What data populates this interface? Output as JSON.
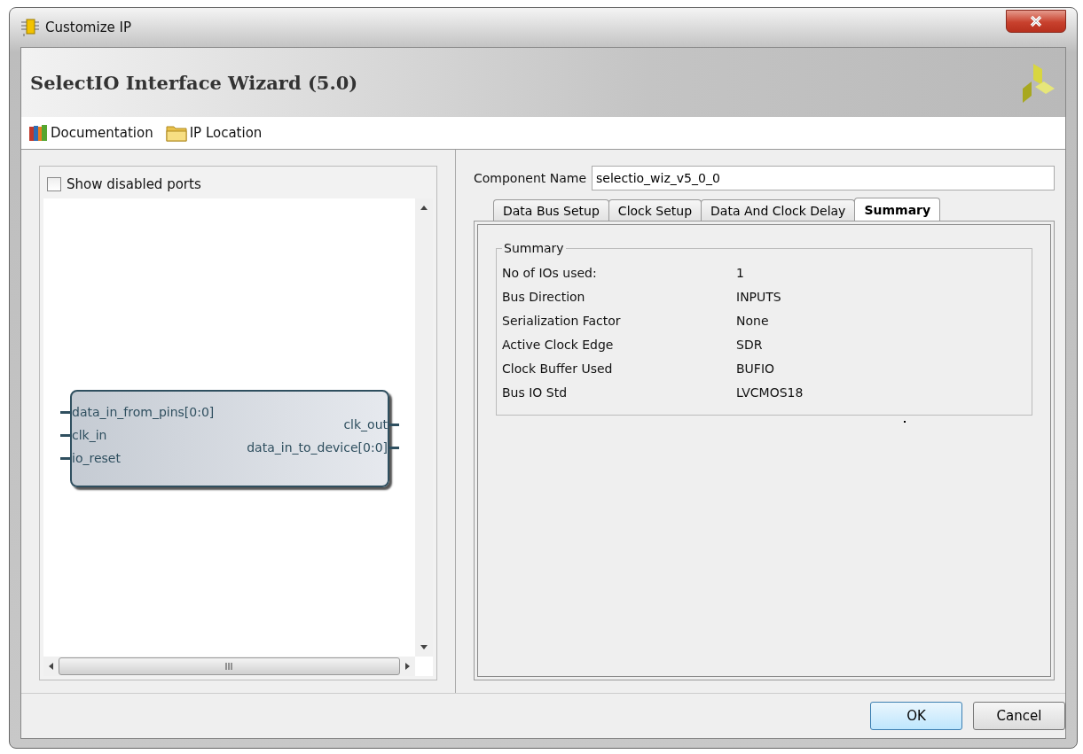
{
  "window": {
    "title": "Customize IP"
  },
  "header": {
    "title": "SelectIO Interface Wizard (5.0)"
  },
  "toolbar": [
    {
      "kind": "books",
      "label": "Documentation"
    },
    {
      "kind": "folder",
      "label": "IP Location"
    }
  ],
  "left_panel": {
    "show_disabled_ports": {
      "label": "Show disabled ports",
      "checked": false
    },
    "block": {
      "inputs": [
        "data_in_from_pins[0:0]",
        "clk_in",
        "io_reset"
      ],
      "outputs": [
        "clk_out",
        "data_in_to_device[0:0]"
      ]
    }
  },
  "component_name": {
    "label": "Component Name",
    "value": "selectio_wiz_v5_0_0"
  },
  "tabs": [
    {
      "label": "Data Bus Setup",
      "selected": false
    },
    {
      "label": "Clock Setup",
      "selected": false
    },
    {
      "label": "Data And Clock Delay",
      "selected": false
    },
    {
      "label": "Summary",
      "selected": true
    }
  ],
  "summary": {
    "title": "Summary",
    "rows": [
      {
        "label": "No of IOs used:",
        "value": "1"
      },
      {
        "label": "Bus Direction",
        "value": "INPUTS"
      },
      {
        "label": "Serialization Factor",
        "value": "None"
      },
      {
        "label": "Active Clock Edge",
        "value": "SDR"
      },
      {
        "label": "Clock Buffer Used",
        "value": "BUFIO"
      },
      {
        "label": "Bus IO Std",
        "value": "LVCMOS18"
      }
    ]
  },
  "buttons": [
    "OK",
    "Cancel"
  ]
}
